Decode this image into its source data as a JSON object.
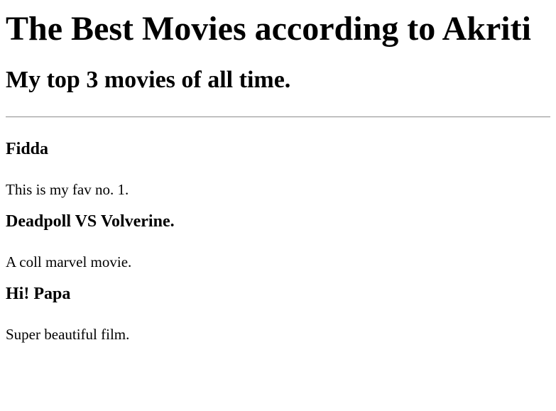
{
  "page": {
    "title": "The Best Movies according to Akriti",
    "subtitle": "My top 3 movies of all time."
  },
  "movies": [
    {
      "title": "Fidda",
      "description": "This is my fav no. 1."
    },
    {
      "title": "Deadpoll VS Volverine.",
      "description": "A coll marvel movie."
    },
    {
      "title": "Hi! Papa",
      "description": "Super beautiful film."
    }
  ]
}
